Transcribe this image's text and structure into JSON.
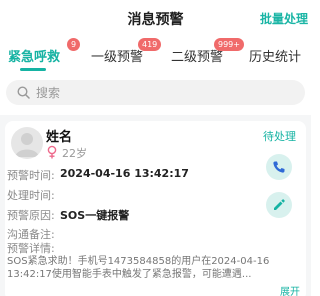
{
  "header": {
    "title": "消息预警",
    "action_label": "批量处理"
  },
  "tabs": [
    {
      "label": "紧急呼救",
      "badge": "9",
      "active": true
    },
    {
      "label": "一级预警",
      "badge": "419",
      "active": false
    },
    {
      "label": "二级预警",
      "badge": "999+",
      "active": false
    },
    {
      "label": "历史统计",
      "badge": "",
      "active": false
    }
  ],
  "search": {
    "placeholder": "搜索"
  },
  "card": {
    "name": "姓名",
    "age": "22岁",
    "status": "待处理",
    "fields": {
      "warning_time_label": "预警时间:",
      "warning_time_value": "2024-04-16 13:42:17",
      "handle_time_label": "处理时间:",
      "handle_time_value": "",
      "reason_label": "预警原因:",
      "reason_value": "SOS一键报警",
      "note_label": "沟通备注:",
      "note_value": "",
      "detail_label": "预警详情:"
    },
    "detail_text": "SOS紧急求助！手机号1473584858的用户在2024-04-16 13:42:17使用智能手表中触发了紧急报警，可能遭遇...",
    "expand_label": "展开"
  },
  "colors": {
    "accent": "#16b3a3",
    "badge": "#f06a6a",
    "background": "#f5f6f7"
  },
  "icons": [
    "search-icon",
    "female-icon",
    "phone-icon",
    "edit-icon",
    "avatar-icon"
  ]
}
